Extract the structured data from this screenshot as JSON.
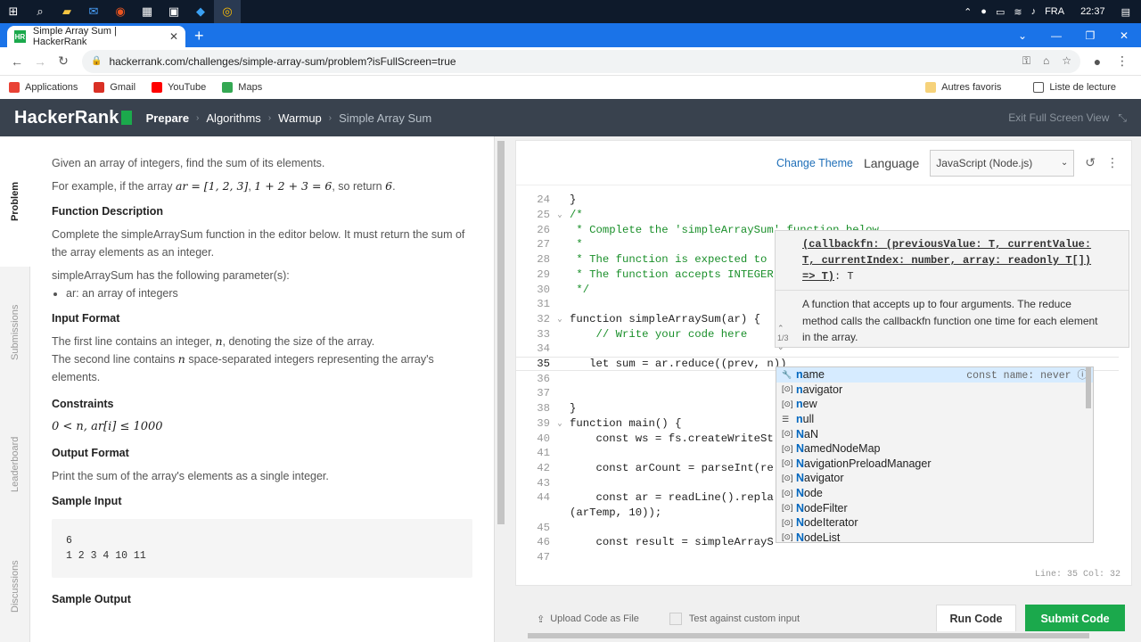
{
  "taskbar": {
    "icons": [
      "windows-start",
      "search",
      "file-explorer",
      "mail",
      "ubuntu",
      "calculator",
      "store",
      "vscode",
      "chrome"
    ],
    "lang": "FRA",
    "time": "22:37"
  },
  "browser": {
    "tab_title": "Simple Array Sum | HackerRank",
    "tab_favicon": "HR",
    "url": "hackerrank.com/challenges/simple-array-sum/problem?isFullScreen=true",
    "bookmarks": [
      {
        "label": "Applications",
        "color": "#e94235"
      },
      {
        "label": "Gmail",
        "color": "#d93025"
      },
      {
        "label": "YouTube",
        "color": "#ff0000"
      },
      {
        "label": "Maps",
        "color": "#34a853"
      }
    ],
    "other_favs": "Autres favoris",
    "reading_list": "Liste de lecture"
  },
  "header": {
    "logo": "HackerRank",
    "breadcrumb": [
      "Prepare",
      "Algorithms",
      "Warmup",
      "Simple Array Sum"
    ],
    "exit_fullscreen": "Exit Full Screen View"
  },
  "sidetabs": [
    "Problem",
    "Submissions",
    "Leaderboard",
    "Discussions"
  ],
  "problem": {
    "intro": "Given an array of integers, find the sum of its elements.",
    "example_prefix": "For example, if the array",
    "example_ar": "ar = [1, 2, 3]",
    "example_sum": "1 + 2 + 3 = 6",
    "example_suffix": ", so return",
    "example_return": "6",
    "func_desc_title": "Function Description",
    "func_desc": "Complete the simpleArraySum function in the editor below. It must return the sum of the array elements as an integer.",
    "params_intro": "simpleArraySum has the following parameter(s):",
    "params": [
      "ar: an array of integers"
    ],
    "input_title": "Input Format",
    "input_line1_a": "The first line contains an integer,",
    "input_line1_var": "n",
    "input_line1_b": ", denoting the size of the array.",
    "input_line2_a": "The second line contains",
    "input_line2_var": "n",
    "input_line2_b": "space-separated integers representing the array's elements.",
    "constraints_title": "Constraints",
    "constraints": "0 < n, ar[i] ≤ 1000",
    "output_title": "Output Format",
    "output": "Print the sum of the array's elements as a single integer.",
    "sample_input_title": "Sample Input",
    "sample_input": "6\n1 2 3 4 10 11",
    "sample_output_title": "Sample Output"
  },
  "editor": {
    "change_theme": "Change Theme",
    "language_label": "Language",
    "language_value": "JavaScript (Node.js)",
    "lines": [
      {
        "n": "24",
        "text": "}",
        "cls": "ct"
      },
      {
        "n": "25",
        "text": "/*",
        "cls": "cmt",
        "fold": true
      },
      {
        "n": "26",
        "text": " * Complete the 'simpleArraySum' function below.",
        "cls": "cmt"
      },
      {
        "n": "27",
        "text": " *",
        "cls": "cmt"
      },
      {
        "n": "28",
        "text": " * The function is expected to",
        "cls": "cmt"
      },
      {
        "n": "29",
        "text": " * The function accepts INTEGER",
        "cls": "cmt"
      },
      {
        "n": "30",
        "text": " */",
        "cls": "cmt"
      },
      {
        "n": "31",
        "text": "",
        "cls": "ct"
      },
      {
        "n": "32",
        "text": "function simpleArraySum(ar) {",
        "cls": "ct",
        "fold": true
      },
      {
        "n": "33",
        "text": "    // Write your code here",
        "cls": "cmt"
      },
      {
        "n": "34",
        "text": "",
        "cls": "ct"
      },
      {
        "n": "35",
        "text": "   let sum = ar.reduce((prev, n))",
        "cls": "ct",
        "current": true
      },
      {
        "n": "36",
        "text": "",
        "cls": "ct"
      },
      {
        "n": "37",
        "text": "",
        "cls": "ct"
      },
      {
        "n": "38",
        "text": "}",
        "cls": "ct"
      },
      {
        "n": "39",
        "text": "function main() {",
        "cls": "ct",
        "fold": true
      },
      {
        "n": "40",
        "text": "    const ws = fs.createWriteSt",
        "cls": "ct"
      },
      {
        "n": "41",
        "text": "",
        "cls": "ct"
      },
      {
        "n": "42",
        "text": "    const arCount = parseInt(re",
        "cls": "ct"
      },
      {
        "n": "43",
        "text": "",
        "cls": "ct"
      },
      {
        "n": "44",
        "text": "    const ar = readLine().repla                                         nt",
        "cls": "ct"
      },
      {
        "n": "",
        "text": "(arTemp, 10));",
        "cls": "ct"
      },
      {
        "n": "45",
        "text": "",
        "cls": "ct"
      },
      {
        "n": "46",
        "text": "    const result = simpleArrayS",
        "cls": "ct"
      },
      {
        "n": "47",
        "text": "",
        "cls": "ct"
      }
    ],
    "status": "Line: 35 Col: 32",
    "hint": {
      "sig_param": "(callbackfn: (previousValue: T, currentValue: T, currentIndex: number, array: readonly T[]) => T)",
      "sig_ret": ": T",
      "desc": "A function that accepts up to four arguments. The reduce method calls the callbackfn function one time for each element in the array.",
      "pager": "1/3"
    },
    "suggestions": [
      {
        "match": "n",
        "rest": "ame",
        "kind": "🔧",
        "detail": "const name: never ⓘ",
        "selected": true
      },
      {
        "match": "n",
        "rest": "avigator",
        "kind": "[⊙]"
      },
      {
        "match": "n",
        "rest": "ew",
        "kind": "[⊙]"
      },
      {
        "match": "n",
        "rest": "ull",
        "kind": "☰"
      },
      {
        "match": "N",
        "rest": "aN",
        "kind": "[⊙]"
      },
      {
        "match": "N",
        "rest": "amedNodeMap",
        "kind": "[⊙]"
      },
      {
        "match": "N",
        "rest": "avigationPreloadManager",
        "kind": "[⊙]"
      },
      {
        "match": "N",
        "rest": "avigator",
        "kind": "[⊙]"
      },
      {
        "match": "N",
        "rest": "ode",
        "kind": "[⊙]"
      },
      {
        "match": "N",
        "rest": "odeFilter",
        "kind": "[⊙]"
      },
      {
        "match": "N",
        "rest": "odeIterator",
        "kind": "[⊙]"
      },
      {
        "match": "N",
        "rest": "odeList",
        "kind": "[⊙]"
      }
    ]
  },
  "bottom": {
    "upload": "Upload Code as File",
    "custom_input": "Test against custom input",
    "run": "Run Code",
    "submit": "Submit Code"
  }
}
